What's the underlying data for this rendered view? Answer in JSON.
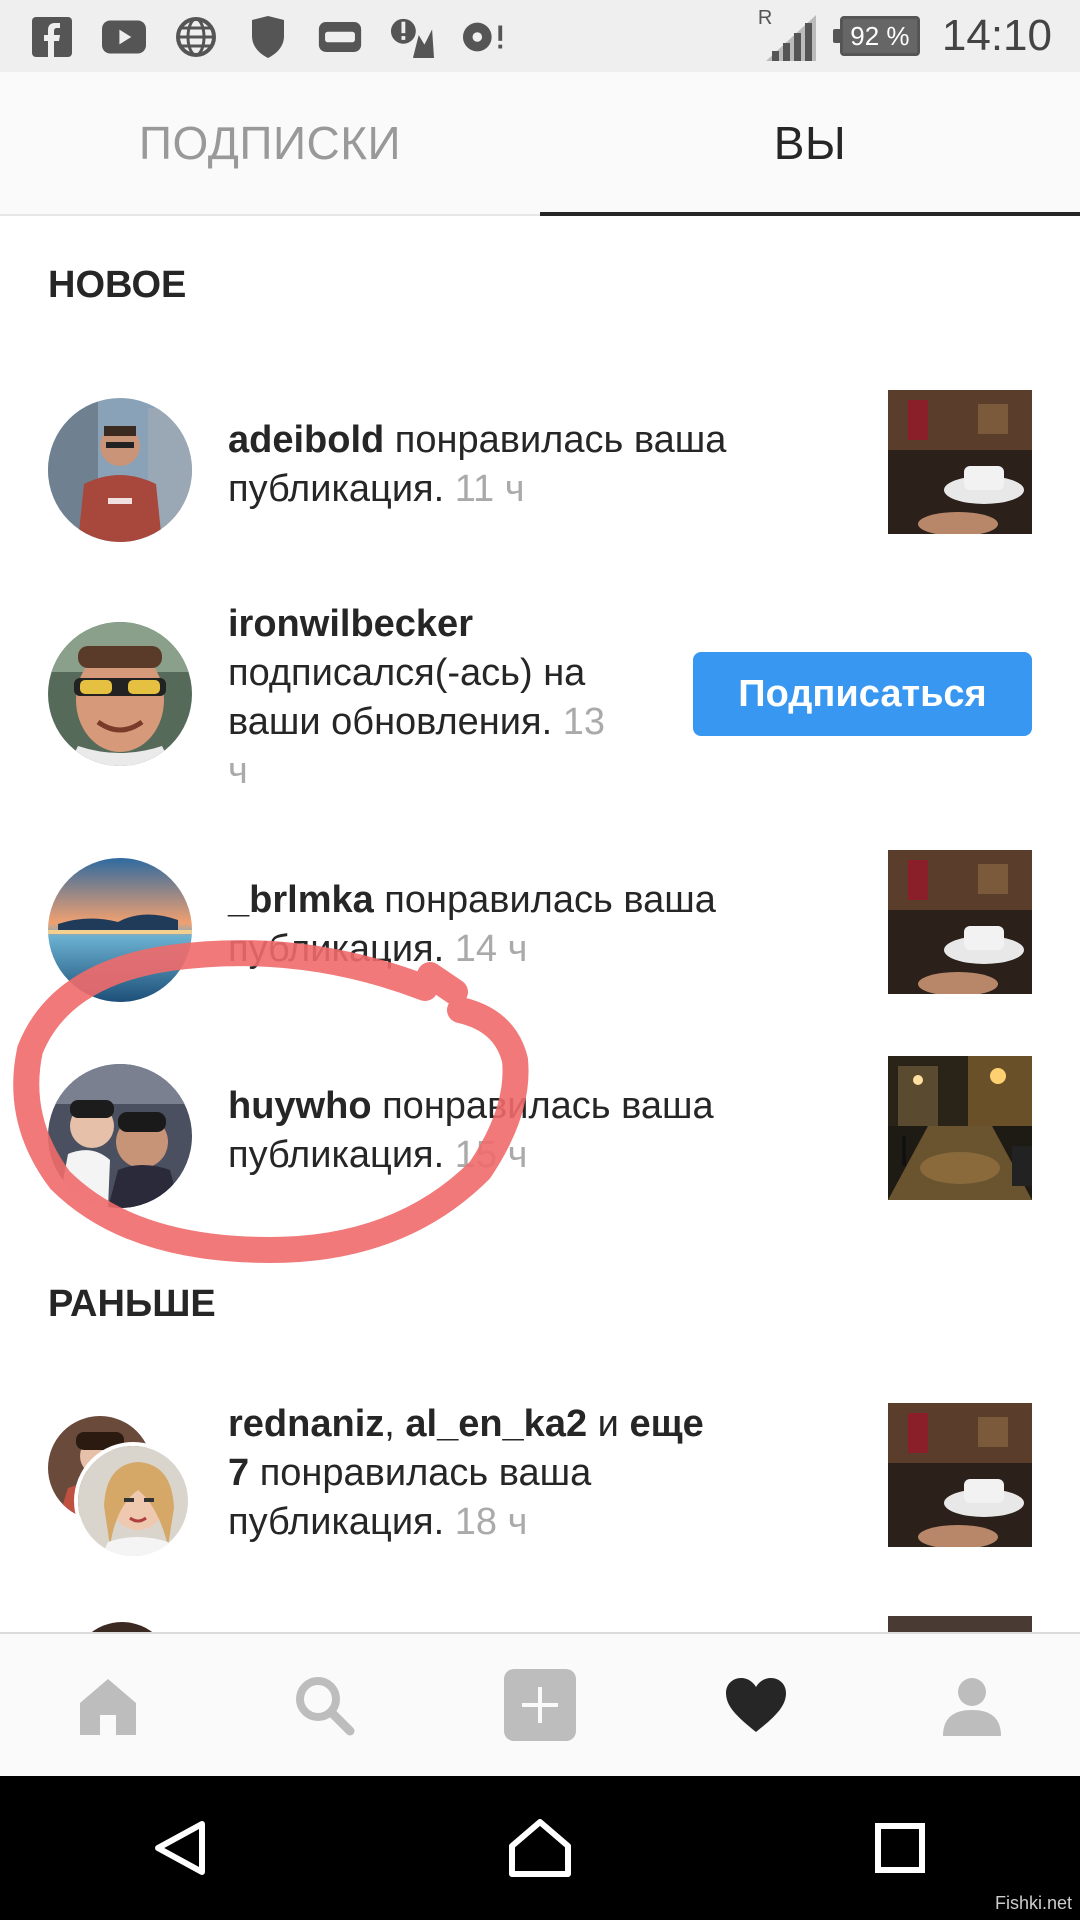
{
  "status_bar": {
    "battery": "92 %",
    "time": "14:10",
    "roaming": "R",
    "icons": [
      "facebook-icon",
      "youtube-icon",
      "globe-icon",
      "shield-icon",
      "gamepad-icon",
      "weather-alert-icon",
      "music-alert-icon"
    ]
  },
  "tabs": {
    "following": "ПОДПИСКИ",
    "you": "ВЫ"
  },
  "sections": {
    "new": "НОВОЕ",
    "earlier": "РАНЬШЕ"
  },
  "notifications": [
    {
      "user": "adeibold",
      "text1": " понравилась ваша",
      "text2": "публикация.",
      "time": " 11 ч"
    },
    {
      "user": "ironwilbecker",
      "line2": "подписался(-ась) на",
      "line3": "ваши обновления.",
      "time_a": " 13",
      "time_b": "ч",
      "button": "Подписаться"
    },
    {
      "user": "_brlmka",
      "text1": " понравилась ваша",
      "text2": "публикация.",
      "time": " 14 ч"
    },
    {
      "user": "huywho",
      "text1": " понравилась ваша",
      "text2": "публикация.",
      "time": " 15 ч"
    },
    {
      "user1": "rednaniz",
      "sep": ", ",
      "user2": "al_en_ka2",
      "and": " и ",
      "more": "еще",
      "count": "7",
      "text1": " понравилась ваша",
      "text2": "публикация.",
      "time": " 18 ч"
    }
  ],
  "bottom_nav": [
    "home-icon",
    "search-icon",
    "add-post-icon",
    "activity-heart-icon",
    "profile-icon"
  ],
  "watermark": "Fishki.net",
  "colors": {
    "accent": "#3897f0",
    "annotation": "#f06a6a"
  }
}
